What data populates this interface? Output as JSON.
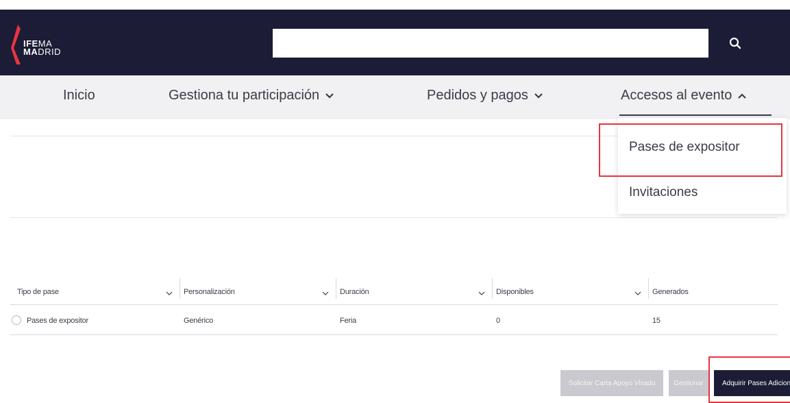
{
  "brand": {
    "logo_line1_bold": "IFE",
    "logo_line1": "MA",
    "logo_line2_bold": "MA",
    "logo_line2": "DRID",
    "accent": "#e8343e",
    "header_bg": "#1c1c36"
  },
  "search": {
    "value": "",
    "icon": "search-icon"
  },
  "nav": {
    "items": [
      {
        "label": "Inicio"
      },
      {
        "label": "Gestiona tu participación"
      },
      {
        "label": "Pedidos y pagos"
      },
      {
        "label": "Accesos al evento"
      }
    ]
  },
  "dropdown": {
    "items": [
      {
        "label": "Pases de expositor"
      },
      {
        "label": "Invitaciones"
      }
    ]
  },
  "table": {
    "headers": [
      "Tipo de pase",
      "Personalización",
      "Duración",
      "Disponibles",
      "Generados"
    ],
    "rows": [
      {
        "cells": [
          "Pases de expositor",
          "Genérico",
          "Feria",
          "0",
          "15"
        ]
      }
    ]
  },
  "actions": {
    "solicitar": "Solicitar Carta Apoyo Visado",
    "gestionar": "Gestionar",
    "adquirir": "Adquirir Pases Adicionales"
  }
}
